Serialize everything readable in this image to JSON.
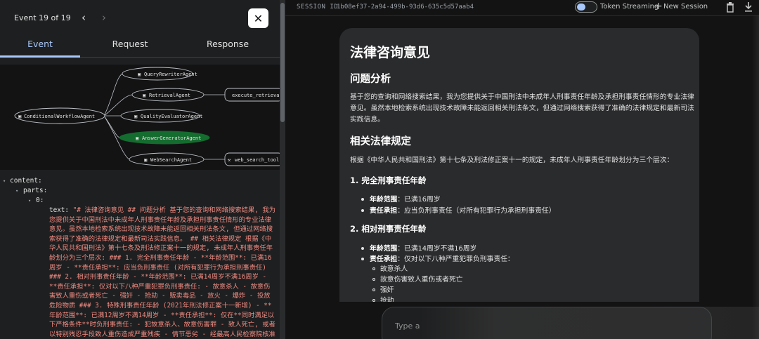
{
  "event_panel": {
    "counter": "Event 19 of 19",
    "tabs": [
      "Event",
      "Request",
      "Response"
    ],
    "graph_nodes": {
      "root": "ConditionalWorkflowAgent",
      "children": [
        "QueryRewriterAgent",
        "RetrievalAgent",
        "QualityEvaluatorAgent",
        "AnswerGeneratorAgent",
        "WebSearchAgent"
      ],
      "tools": [
        "execute_retrieval",
        "web_search_tool"
      ]
    },
    "tree": {
      "content_key": "content:",
      "parts_key": "parts:",
      "index_key": "0:",
      "text_key": "text:",
      "text_value": "\"# 法律咨询意见  ## 问题分析  基于您的查询和网络搜索结果, 我为您提供关于中国刑法中未成年人刑事责任年龄及承担刑事责任情形的专业法律意见。虽然本地检索系统出现技术故障未能返回相关刑法条文, 但通过网络搜索获得了准确的法律规定和最新司法实践信息。  ## 相关法律规定  根据《中华人民共和国刑法》第十七条及刑法修正案十一的规定, 未成年人刑事责任年龄划分为三个层次:  ### 1. 完全刑事责任年龄 - **年龄范围**: 已满16周岁 - **责任承担**: 应当负刑事责任 (对所有犯罪行为承担刑事责任)  ### 2. 相对刑事责任年龄 - **年龄范围**: 已满14周岁不满16周岁 - **责任承担**: 仅对以下八种严重犯罪负刑事责任:  - 故意杀人 - 故意伤害致人重伤或者死亡 - 强奸 - 抢劫 - 贩卖毒品 - 放火 - 爆炸 - 投放危险物质  ### 3. 特殊刑事责任年龄 (2021年刑法修正案十一新增)  - **年龄范围**: 已满12周岁不满14周岁 - **责任承担**: 仅在**同时满足以下严格条件**时负刑事责任:  - 犯故意杀人、故意伤害罪 - 致人死亡, 或者以特别残忍手段致人重伤造成严重残疾 - 情节恶劣 - 经最高人民检察院核准追诉  ## 法律解释 ###"
    }
  },
  "session": {
    "label": "SESSION ID",
    "id": "1b08ef37-2a94-499b-93d6-635c5d57aab4",
    "token_streaming_label": "Token Streaming",
    "new_session_label": "New Session"
  },
  "message": {
    "title": "法律咨询意见",
    "h_analysis": "问题分析",
    "p_analysis": "基于您的查询和网络搜索结果，我为您提供关于中国刑法中未成年人刑事责任年龄及承担刑事责任情形的专业法律意见。虽然本地检索系统出现技术故障未能返回相关刑法条文，但通过网络搜索获得了准确的法律规定和最新司法实践信息。",
    "h_law": "相关法律规定",
    "p_law": "根据《中华人民共和国刑法》第十七条及刑法修正案十一的规定，未成年人刑事责任年龄划分为三个层次：",
    "s1_title": "1. 完全刑事责任年龄",
    "s1_range_label": "年龄范围",
    "s1_range": "：已满16周岁",
    "s1_resp_label": "责任承担",
    "s1_resp": "：应当负刑事责任（对所有犯罪行为承担刑事责任）",
    "s2_title": "2. 相对刑事责任年龄",
    "s2_range_label": "年龄范围",
    "s2_range": "：已满14周岁不满16周岁",
    "s2_resp_label": "责任承担",
    "s2_resp": "：仅对以下八种严重犯罪负刑事责任：",
    "s2_items": [
      "故意杀人",
      "故意伤害致人重伤或者死亡",
      "强奸",
      "抢劫"
    ]
  },
  "input": {
    "placeholder": "Type a"
  },
  "colors": {
    "accent": "#a8c7fa",
    "active_node": "#146c2e",
    "json_string": "#f28b82"
  }
}
